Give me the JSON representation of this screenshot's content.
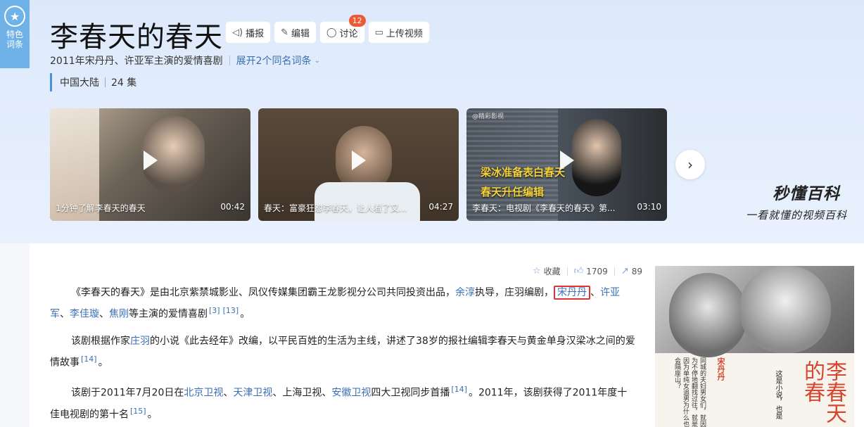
{
  "ribbon": {
    "label": "特色词条",
    "icon": "star-badge-icon"
  },
  "header": {
    "title": "李春天的春天",
    "actions": [
      {
        "label": "播报",
        "icon": "speaker-icon"
      },
      {
        "label": "编辑",
        "icon": "pencil-icon"
      },
      {
        "label": "讨论",
        "icon": "chat-bubble-icon",
        "badge": "12"
      },
      {
        "label": "上传视频",
        "icon": "video-upload-icon"
      }
    ],
    "subtitle": "2011年宋丹丹、许亚军主演的爱情喜剧",
    "expand_link": "展开2个同名词条",
    "tags": [
      "中国大陆",
      "24 集"
    ]
  },
  "videos": [
    {
      "title": "1分钟了解李春天的春天",
      "duration": "00:42"
    },
    {
      "title": "春天：富豪狂怼李春天，让人看了又...",
      "duration": "04:27"
    },
    {
      "title": "李春天：电视剧《李春天的春天》第...",
      "duration": "03:10",
      "caption_lines": [
        "梁冰准备表白春天",
        "春天升任编辑"
      ],
      "watermark": "@精彩影视"
    }
  ],
  "brand": {
    "name": "秒懂百科",
    "slogan": "一看就懂的视频百科"
  },
  "meta": {
    "favorite_label": "收藏",
    "likes": "1709",
    "shares": "89"
  },
  "article": {
    "p1": {
      "t1": "《李春天的春天》是由北京紫禁城影业、凤仪传媒集团霸王龙影视分公司共同投资出品，",
      "l1": "余淳",
      "t2": "执导，庄羽编剧，",
      "l2": "宋丹丹",
      "t3": "、",
      "l3": "许亚军",
      "t4": "、",
      "l4": "李佳璇",
      "t5": "、",
      "l5": "焦刚",
      "t6": "等主演的爱情喜剧",
      "r1": "[3]",
      "r2": "[13]",
      "t7": "。"
    },
    "p2": {
      "t1": "该剧根据作家",
      "l1": "庄羽",
      "t2": "的小说《此去经年》改编，以平民百姓的生活为主线，讲述了38岁的报社编辑李春天与黄金单身汉梁冰之间的爱情故事",
      "r1": "[14]",
      "t3": "。"
    },
    "p3": {
      "t1": "该剧于2011年7月20日在",
      "l1": "北京卫视",
      "t2": "、",
      "l2": "天津卫视",
      "t3": "、上海卫视、",
      "l3": "安徽卫视",
      "t4": "四大卫视同步首播",
      "r1": "[14]",
      "t5": "。2011年，该剧获得了2011年度十佳电视剧的第十名",
      "r2": "[15]",
      "t6": "。"
    }
  },
  "poster": {
    "title": "李春天的春",
    "actor_name": "宋丹丹",
    "side_text": "这是小说，也是",
    "body_text": "同城的夫妇男女们，就因为不停地翻找过往，就是因为单纯女追男为什么也会隔座山？"
  },
  "colors": {
    "link": "#3a6fb5",
    "badge": "#ee5a35",
    "accent_bar": "#4a90e2",
    "highlight_box": "#e03232",
    "ribbon": "#6fb2e8"
  }
}
